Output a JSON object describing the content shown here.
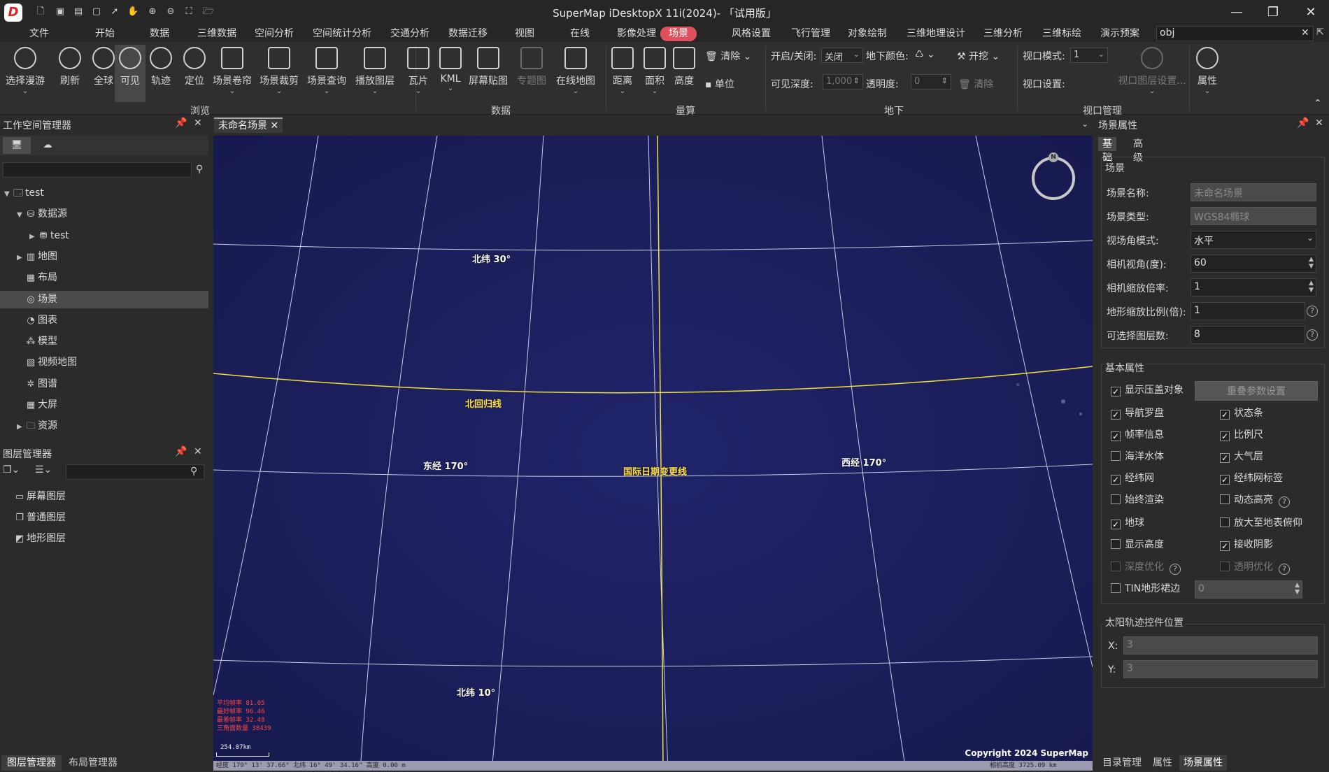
{
  "app": {
    "title": "SuperMap iDesktopX 11i(2024)- 「试用版」",
    "logo_text": "D"
  },
  "quick_access": [
    {
      "icon": "new-file-icon",
      "glyph": "🗋"
    },
    {
      "icon": "save-icon",
      "glyph": "▣"
    },
    {
      "icon": "save-as-icon",
      "glyph": "▤"
    },
    {
      "icon": "window-icon",
      "glyph": "▢"
    },
    {
      "icon": "pointer-icon",
      "glyph": "➚"
    },
    {
      "icon": "pan-hand-icon",
      "glyph": "✋"
    },
    {
      "icon": "zoom-in-icon",
      "glyph": "⊕"
    },
    {
      "icon": "zoom-out-icon",
      "glyph": "⊖"
    },
    {
      "icon": "full-extent-icon",
      "glyph": "⛶"
    },
    {
      "icon": "open-folder-icon",
      "glyph": "🗁"
    }
  ],
  "menu_tabs": [
    "文件",
    "开始",
    "数据",
    "三维数据",
    "空间分析",
    "空间统计分析",
    "交通分析",
    "数据迁移",
    "视图",
    "在线",
    "影像处理",
    "场景",
    "风格设置",
    "飞行管理",
    "对象绘制",
    "三维地理设计",
    "三维分析",
    "三维标绘",
    "演示预案"
  ],
  "menu_active": "场景",
  "search_value": "obj",
  "ribbon": {
    "browse_buttons": [
      "选择漫游",
      "刷新",
      "全球",
      "可见",
      "轨迹",
      "定位",
      "场景卷帘",
      "场景裁剪",
      "场景查询",
      "播放图层"
    ],
    "data_buttons": [
      "瓦片",
      "KML",
      "屏幕贴图",
      "专题图",
      "在线地图"
    ],
    "measure_buttons": [
      "距离",
      "面积",
      "高度"
    ],
    "clear_label": "清除",
    "unit_label": "单位",
    "underground": {
      "onoff_label": "开启/关闭:",
      "onoff_value": "关闭",
      "color_label": "地下颜色:",
      "excavate_label": "开挖",
      "depth_label": "可见深度:",
      "depth_value": "1,000",
      "transparency_label": "透明度:",
      "transparency_value": "0",
      "clear_label": "清除"
    },
    "viewport": {
      "mode_label": "视口模式:",
      "mode_value": "1",
      "settings_label": "视口设置:",
      "layer_settings_label": "视口图层设置..."
    },
    "properties_label": "属性",
    "groups": {
      "browse": "浏览",
      "data": "数据",
      "measure": "量算",
      "underground": "地下",
      "viewport": "视口管理"
    }
  },
  "workspace": {
    "title": "工作空间管理器",
    "tree": [
      {
        "label": "test",
        "level": 0,
        "expand": "▼",
        "icon": "workspace-icon",
        "glyph": "🗔"
      },
      {
        "label": "数据源",
        "level": 1,
        "expand": "▼",
        "icon": "datasource-icon",
        "glyph": "⛁"
      },
      {
        "label": "test",
        "level": 2,
        "expand": "▶",
        "icon": "udbx-icon",
        "glyph": "⛃"
      },
      {
        "label": "地图",
        "level": 1,
        "expand": "▶",
        "icon": "map-icon",
        "glyph": "▥"
      },
      {
        "label": "布局",
        "level": 1,
        "expand": "",
        "icon": "layout-icon",
        "glyph": "▦"
      },
      {
        "label": "场景",
        "level": 1,
        "expand": "",
        "icon": "scene-icon",
        "glyph": "◎",
        "selected": true
      },
      {
        "label": "图表",
        "level": 1,
        "expand": "",
        "icon": "chart-icon",
        "glyph": "◔"
      },
      {
        "label": "模型",
        "level": 1,
        "expand": "",
        "icon": "model-icon",
        "glyph": "⁂"
      },
      {
        "label": "视频地图",
        "level": 1,
        "expand": "",
        "icon": "video-map-icon",
        "glyph": "▧"
      },
      {
        "label": "图谱",
        "level": 1,
        "expand": "",
        "icon": "graph-icon",
        "glyph": "✲"
      },
      {
        "label": "大屏",
        "level": 1,
        "expand": "",
        "icon": "big-screen-icon",
        "glyph": "▦"
      },
      {
        "label": "资源",
        "level": 1,
        "expand": "▶",
        "icon": "resource-folder-icon",
        "glyph": "🗀"
      }
    ]
  },
  "layers": {
    "title": "图层管理器",
    "items": [
      {
        "label": "屏幕图层",
        "icon": "screen-layer-icon",
        "glyph": "▭"
      },
      {
        "label": "普通图层",
        "icon": "normal-layer-icon",
        "glyph": "❐"
      },
      {
        "label": "地形图层",
        "icon": "terrain-layer-icon",
        "glyph": "◩"
      }
    ]
  },
  "left_bottom_tabs": [
    "图层管理器",
    "布局管理器"
  ],
  "scene": {
    "tab_label": "未命名场景",
    "labels": {
      "lat30": "北纬 30°",
      "tropic": "北回归线",
      "lon_e170": "东经 170°",
      "dateline": "国际日期变更线",
      "lon_w170": "西经 170°",
      "lat10": "北纬 10°"
    },
    "fps": [
      "平均帧率 81.05",
      "最好帧率 96.46",
      "最差帧率 32.48",
      "三角面数量 38439"
    ],
    "scale": "254.07km",
    "copyright": "Copyright 2024 SuperMap",
    "status_left": "经度 179° 13' 37.66\"  北纬 16° 49' 34.16\"  高度 0.00 m",
    "status_right": "相机高度 3725.09 km"
  },
  "props": {
    "title": "场景属性",
    "tabs": [
      "基础",
      "高级"
    ],
    "scene_group": "场景",
    "scene_name_label": "场景名称:",
    "scene_name_value": "未命名场景",
    "scene_type_label": "场景类型:",
    "scene_type_value": "WGS84椭球",
    "fov_mode_label": "视场角模式:",
    "fov_mode_value": "水平",
    "camera_angle_label": "相机视角(度):",
    "camera_angle_value": "60",
    "camera_zoom_label": "相机缩放倍率:",
    "camera_zoom_value": "1",
    "terrain_scale_label": "地形缩放比例(倍):",
    "terrain_scale_value": "1",
    "selectable_layers_label": "可选择图层数:",
    "selectable_layers_value": "8",
    "basic_group": "基本属性",
    "overlap_button": "重叠参数设置",
    "checkboxes": [
      {
        "label": "显示压盖对象",
        "checked": true,
        "col": 0,
        "row": 0,
        "dim": false
      },
      {
        "label": "导航罗盘",
        "checked": true,
        "col": 0,
        "row": 1,
        "dim": false
      },
      {
        "label": "状态条",
        "checked": true,
        "col": 1,
        "row": 1,
        "dim": false
      },
      {
        "label": "帧率信息",
        "checked": true,
        "col": 0,
        "row": 2,
        "dim": false
      },
      {
        "label": "比例尺",
        "checked": true,
        "col": 1,
        "row": 2,
        "dim": false
      },
      {
        "label": "海洋水体",
        "checked": false,
        "col": 0,
        "row": 3,
        "dim": false
      },
      {
        "label": "大气层",
        "checked": true,
        "col": 1,
        "row": 3,
        "dim": false
      },
      {
        "label": "经纬网",
        "checked": true,
        "col": 0,
        "row": 4,
        "dim": false
      },
      {
        "label": "经纬网标签",
        "checked": true,
        "col": 1,
        "row": 4,
        "dim": false
      },
      {
        "label": "始终渲染",
        "checked": false,
        "col": 0,
        "row": 5,
        "dim": false
      },
      {
        "label": "动态高亮",
        "checked": false,
        "col": 1,
        "row": 5,
        "dim": false,
        "help": true
      },
      {
        "label": "地球",
        "checked": true,
        "col": 0,
        "row": 6,
        "dim": false
      },
      {
        "label": "放大至地表俯仰",
        "checked": false,
        "col": 1,
        "row": 6,
        "dim": false
      },
      {
        "label": "显示高度",
        "checked": false,
        "col": 0,
        "row": 7,
        "dim": false
      },
      {
        "label": "接收阴影",
        "checked": true,
        "col": 1,
        "row": 7,
        "dim": false
      },
      {
        "label": "深度优化",
        "checked": false,
        "col": 0,
        "row": 8,
        "dim": true,
        "help": true
      },
      {
        "label": "透明优化",
        "checked": false,
        "col": 1,
        "row": 8,
        "dim": true,
        "help": true
      },
      {
        "label": "TIN地形裙边",
        "checked": false,
        "col": 0,
        "row": 9,
        "dim": false
      }
    ],
    "tin_value": "0",
    "sun_group": "太阳轨迹控件位置",
    "sun_x_label": "X:",
    "sun_x_value": "3",
    "sun_y_label": "Y:",
    "sun_y_value": "3"
  },
  "right_bottom_tabs": [
    "目录管理",
    "属性",
    "场景属性"
  ]
}
